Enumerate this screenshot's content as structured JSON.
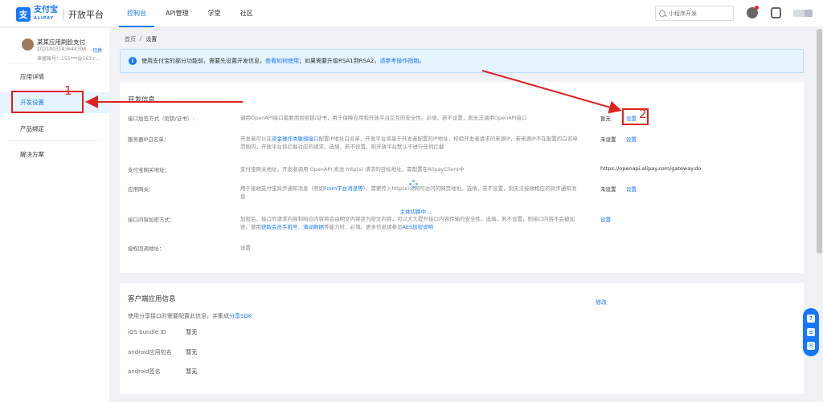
{
  "header": {
    "logo_mark": "支",
    "logo_text": "支付宝",
    "logo_sub": "ALIPAY",
    "platform": "开放平台",
    "tabs": [
      {
        "label": "控制台"
      },
      {
        "label": "API管理"
      },
      {
        "label": "学堂"
      },
      {
        "label": "社区"
      }
    ],
    "active_tab": "控制台",
    "search_placeholder": "小程序开发"
  },
  "sidebar": {
    "app_name": "某某应用刷脸支付",
    "app_id": "2021003143644398",
    "switch_label": "切换",
    "account": "来届账号：155***@163.c...",
    "items": [
      {
        "label": "应用详情"
      },
      {
        "label": "开发设置"
      },
      {
        "label": "产品绑定"
      },
      {
        "label": "解决方案"
      }
    ]
  },
  "breadcrumb": {
    "home": "首页",
    "sep": "/",
    "current": "设置"
  },
  "alert": {
    "icon": "i",
    "text_prefix": "使用支付宝的部分功能前，需要先设置开发信息，",
    "link1": "查看如何使用",
    "text_mid": "；如果需要升级RSA1到RSA2，",
    "link2": "请参考操作指南",
    "text_suffix": "。"
  },
  "dev_info": {
    "title": "开发信息",
    "rows": [
      {
        "label": "接口加签方式（密钥/证书）:",
        "desc": "调用OpenAPI接口需要用到密钥/证书，用于保障应用和开放平台交互的安全性。必填，若不设置，则无法调用OpenAPI接口",
        "value": "暂无",
        "action": "设置"
      },
      {
        "label": "服务器IP白名单：",
        "desc_before": "开发者可以在",
        "desc_link": "资金操作类敏感接口",
        "desc_after": "配置IP地址白名单，开发平台将基于开发者配置的IP地址，校验开发者请求的来源IP，若来源IP不在配置的白名单范围内，开放平台将拦截对应的请求。选填，若不设置，则开放平台默认不进行任何拦截",
        "value": "未设置",
        "action": "设置"
      },
      {
        "label": "支付宝网关地址：",
        "desc": "支付宝网关地址，开发者调用 OpenAPI 发送 http(s) 请求的目标地址，需配置在AlipayClient中",
        "value": "https://openapi.alipay.com/gateway.do"
      },
      {
        "label": "应用网关：",
        "desc_before": "用于接收支付宝异步通知消息（例如",
        "desc_link": "From平台消息等",
        "desc_after": "），需要传入http(s)公网可访问的网页地址。选填，若不设置，则无法接收相应的异步通知消息",
        "value": "未设置",
        "action": "设置"
      },
      {
        "label": "接口内容加密方式：",
        "desc_before": "加密后，接口的请求内容和响应内容将会由明文内容变为密文内容，可以大大提升接口内容传输的安全性。选填，若不设置，则接口内容不会被加密。使用",
        "desc_link1": "获取会员手机号",
        "desc_mid": "、",
        "desc_link2": "滴动数据",
        "desc_after": "等能力时，必填。更多信息请参见",
        "desc_link3": "AES加密说明",
        "action": "设置"
      },
      {
        "label": "授权回调地址：",
        "desc_link": "设置"
      }
    ],
    "loading_text": "主体切换中..."
  },
  "client_info": {
    "title": "客户端应用信息",
    "edit": "修改",
    "subtitle_before": "使用分享接口时需要配置此信息，并集成",
    "subtitle_link": "分享SDK",
    "rows": [
      {
        "key": "iOS bundle ID",
        "value": "暂无"
      },
      {
        "key": "android应用包名",
        "value": "暂无"
      },
      {
        "key": "android签名",
        "value": "暂无"
      }
    ]
  },
  "annotations": {
    "num1": "1",
    "num2": "2",
    "color": "#e02020"
  },
  "float_help": [
    "?",
    "≡",
    "✉"
  ]
}
